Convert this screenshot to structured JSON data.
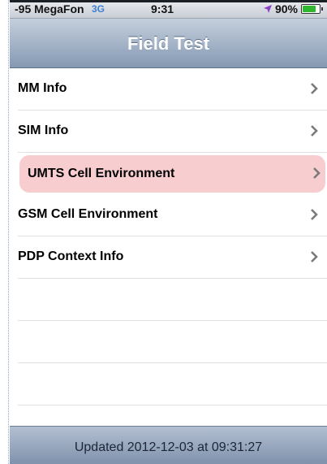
{
  "status_bar": {
    "carrier": "-95 MegaFon",
    "network": "3G",
    "time": "9:31",
    "battery": "90%",
    "battery_level": 0.9,
    "colors": {
      "network": "#3f7fd0",
      "battery_fill": "#2fb82f",
      "location_arrow": "#8a3fc7"
    }
  },
  "nav": {
    "title": "Field Test"
  },
  "menu": {
    "items": [
      {
        "label": "MM Info",
        "selected": false
      },
      {
        "label": "SIM Info",
        "selected": false
      },
      {
        "label": "UMTS Cell Environment",
        "selected": true
      },
      {
        "label": "GSM Cell Environment",
        "selected": false
      },
      {
        "label": "PDP Context Info",
        "selected": false
      }
    ],
    "highlight_color": "#f8cdd0"
  },
  "footer": {
    "updated": "Updated 2012-12-03 at 09:31:27"
  },
  "icons": {
    "row_disclosure": "chevron-right-icon",
    "location": "location-arrow-icon",
    "battery": "battery-icon"
  }
}
